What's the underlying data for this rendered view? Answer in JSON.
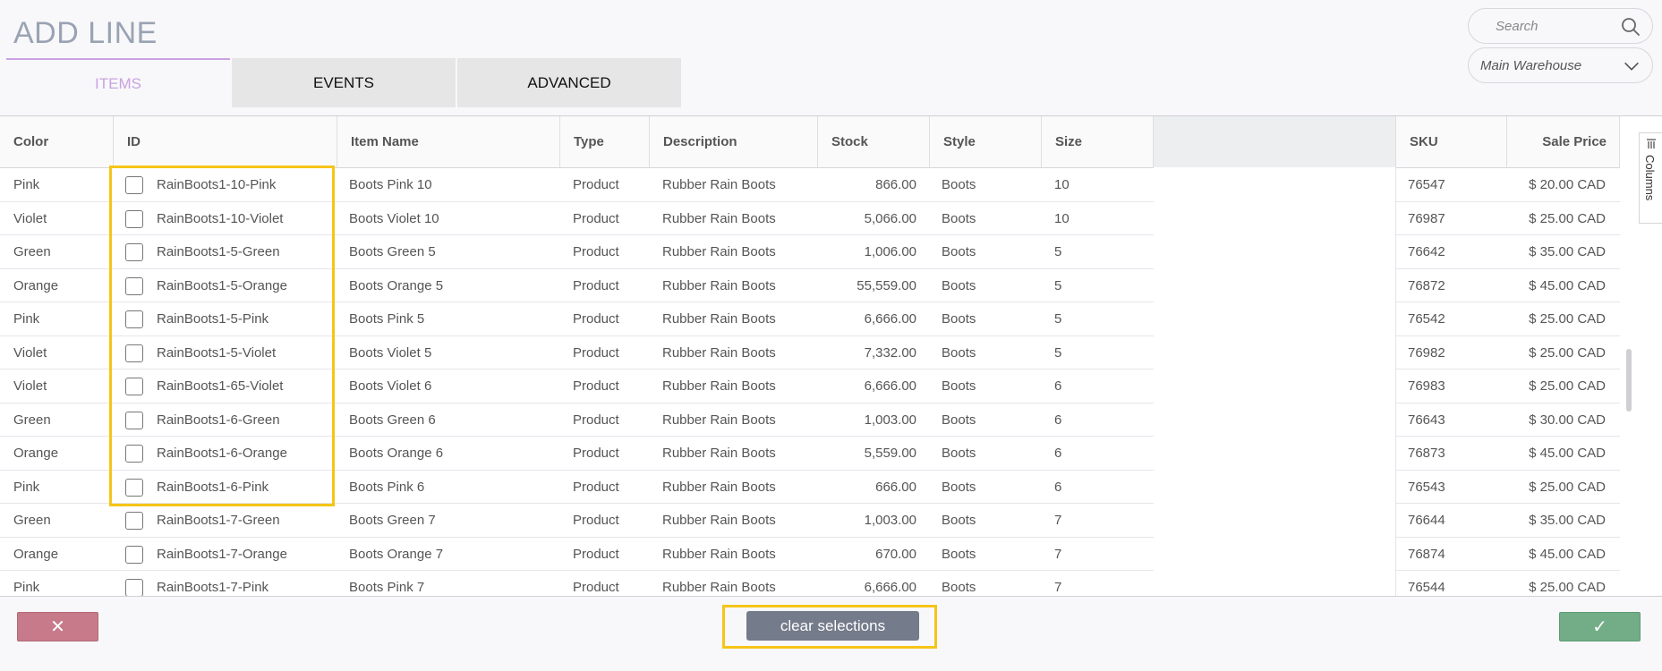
{
  "title": "ADD LINE",
  "tabs": [
    {
      "label": "ITEMS",
      "active": true
    },
    {
      "label": "EVENTS",
      "active": false
    },
    {
      "label": "ADVANCED",
      "active": false
    }
  ],
  "search": {
    "placeholder": "Search",
    "icon": "search-icon"
  },
  "warehouse": {
    "selected": "Main Warehouse",
    "icon": "chevron-down-icon"
  },
  "grid": {
    "columns": [
      "Color",
      "ID",
      "Item Name",
      "Type",
      "Description",
      "Stock",
      "Style",
      "Size",
      "SKU",
      "Sale Price"
    ],
    "rows": [
      {
        "color": "Pink",
        "id": "RainBoots1-10-Pink",
        "name": "Boots Pink 10",
        "type": "Product",
        "description": "Rubber Rain Boots",
        "stock": "866.00",
        "style": "Boots",
        "size": "10",
        "sku": "76547",
        "price": "$ 20.00 CAD"
      },
      {
        "color": "Violet",
        "id": "RainBoots1-10-Violet",
        "name": "Boots Violet 10",
        "type": "Product",
        "description": "Rubber Rain Boots",
        "stock": "5,066.00",
        "style": "Boots",
        "size": "10",
        "sku": "76987",
        "price": "$ 25.00 CAD"
      },
      {
        "color": "Green",
        "id": "RainBoots1-5-Green",
        "name": "Boots Green 5",
        "type": "Product",
        "description": "Rubber Rain Boots",
        "stock": "1,006.00",
        "style": "Boots",
        "size": "5",
        "sku": "76642",
        "price": "$ 35.00 CAD"
      },
      {
        "color": "Orange",
        "id": "RainBoots1-5-Orange",
        "name": "Boots Orange 5",
        "type": "Product",
        "description": "Rubber Rain Boots",
        "stock": "55,559.00",
        "style": "Boots",
        "size": "5",
        "sku": "76872",
        "price": "$ 45.00 CAD"
      },
      {
        "color": "Pink",
        "id": "RainBoots1-5-Pink",
        "name": "Boots Pink 5",
        "type": "Product",
        "description": "Rubber Rain Boots",
        "stock": "6,666.00",
        "style": "Boots",
        "size": "5",
        "sku": "76542",
        "price": "$ 25.00 CAD"
      },
      {
        "color": "Violet",
        "id": "RainBoots1-5-Violet",
        "name": "Boots Violet 5",
        "type": "Product",
        "description": "Rubber Rain Boots",
        "stock": "7,332.00",
        "style": "Boots",
        "size": "5",
        "sku": "76982",
        "price": "$ 25.00 CAD"
      },
      {
        "color": "Violet",
        "id": "RainBoots1-65-Violet",
        "name": "Boots Violet 6",
        "type": "Product",
        "description": "Rubber Rain Boots",
        "stock": "6,666.00",
        "style": "Boots",
        "size": "6",
        "sku": "76983",
        "price": "$ 25.00 CAD"
      },
      {
        "color": "Green",
        "id": "RainBoots1-6-Green",
        "name": "Boots Green 6",
        "type": "Product",
        "description": "Rubber Rain Boots",
        "stock": "1,003.00",
        "style": "Boots",
        "size": "6",
        "sku": "76643",
        "price": "$ 30.00 CAD"
      },
      {
        "color": "Orange",
        "id": "RainBoots1-6-Orange",
        "name": "Boots Orange 6",
        "type": "Product",
        "description": "Rubber Rain Boots",
        "stock": "5,559.00",
        "style": "Boots",
        "size": "6",
        "sku": "76873",
        "price": "$ 45.00 CAD"
      },
      {
        "color": "Pink",
        "id": "RainBoots1-6-Pink",
        "name": "Boots Pink 6",
        "type": "Product",
        "description": "Rubber Rain Boots",
        "stock": "666.00",
        "style": "Boots",
        "size": "6",
        "sku": "76543",
        "price": "$ 25.00 CAD"
      },
      {
        "color": "Green",
        "id": "RainBoots1-7-Green",
        "name": "Boots Green 7",
        "type": "Product",
        "description": "Rubber Rain Boots",
        "stock": "1,003.00",
        "style": "Boots",
        "size": "7",
        "sku": "76644",
        "price": "$ 35.00 CAD"
      },
      {
        "color": "Orange",
        "id": "RainBoots1-7-Orange",
        "name": "Boots Orange 7",
        "type": "Product",
        "description": "Rubber Rain Boots",
        "stock": "670.00",
        "style": "Boots",
        "size": "7",
        "sku": "76874",
        "price": "$ 45.00 CAD"
      },
      {
        "color": "Pink",
        "id": "RainBoots1-7-Pink",
        "name": "Boots Pink 7",
        "type": "Product",
        "description": "Rubber Rain Boots",
        "stock": "6,666.00",
        "style": "Boots",
        "size": "7",
        "sku": "76544",
        "price": "$ 25.00 CAD"
      }
    ]
  },
  "side_panel": {
    "columns_label": "Columns"
  },
  "footer": {
    "cancel_label": "✕",
    "clear_label": "clear selections",
    "confirm_label": "✓"
  },
  "colors": {
    "accent": "#c9a3e0",
    "highlight": "#f5c518",
    "cancel": "#c77a89",
    "confirm": "#72ad87",
    "clear": "#747b8a"
  }
}
